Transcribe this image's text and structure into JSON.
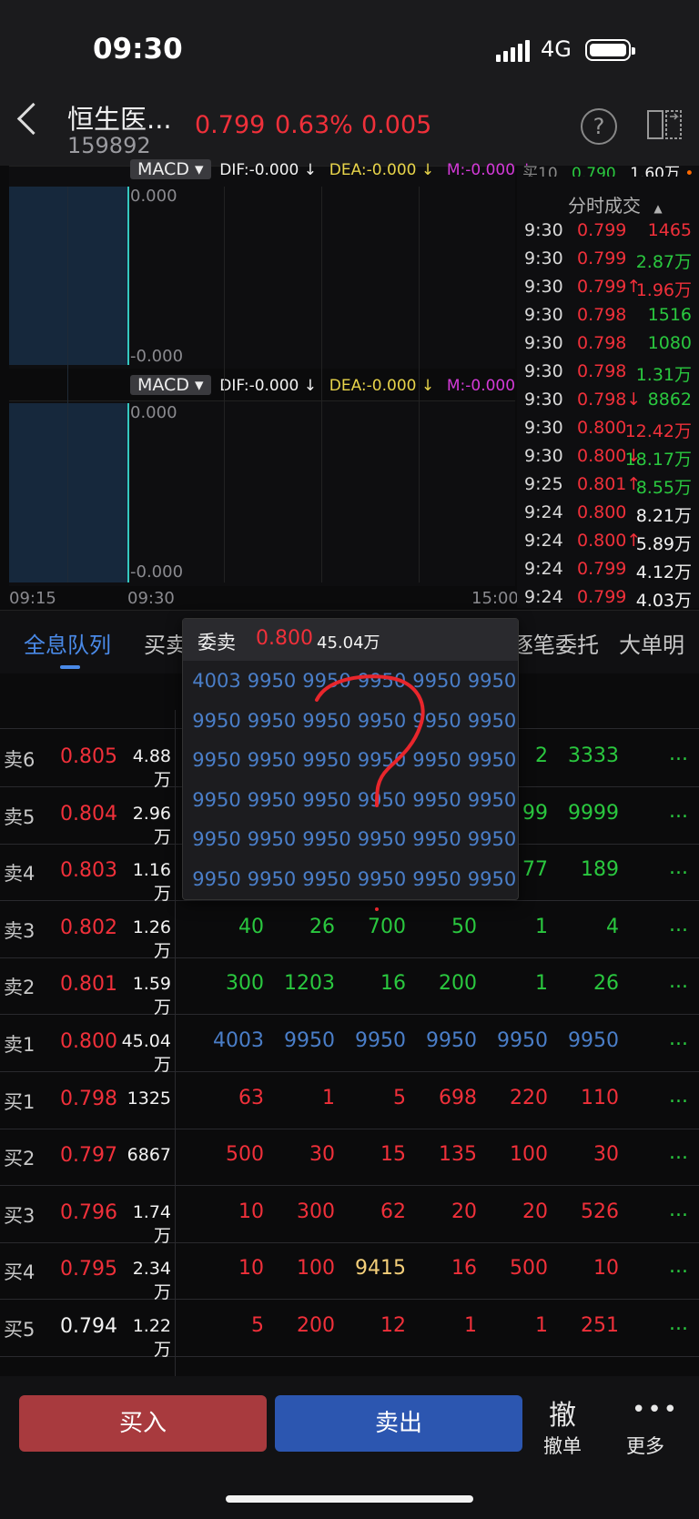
{
  "status_bar": {
    "time": "09:30",
    "network": "4G"
  },
  "header": {
    "name": "恒生医...",
    "code": "159892",
    "price": "0.799",
    "pct": "0.63%",
    "change": "0.005"
  },
  "indicators": [
    {
      "button": "MACD",
      "dif": "DIF:-0.000 ↓",
      "dea": "DEA:-0.000 ↓",
      "m": "M:-0.000 ↓",
      "top": "0.000",
      "bottom": "-0.000"
    },
    {
      "button": "MACD",
      "dif": "DIF:-0.000 ↓",
      "dea": "DEA:-0.000 ↓",
      "m": "M:-0.000 ↓",
      "top": "0.000",
      "bottom": "-0.000"
    }
  ],
  "time_axis": {
    "start": "09:15",
    "mid": "09:30",
    "end": "15:00"
  },
  "ticks": {
    "partial_top": {
      "label": "买10",
      "price": "0.790",
      "vol": "1.60万"
    },
    "header": "分时成交",
    "rows": [
      {
        "t": "9:30",
        "p": "0.799",
        "v": "1465",
        "pc": "red",
        "vc": "red"
      },
      {
        "t": "9:30",
        "p": "0.799",
        "v": "2.87万",
        "pc": "red",
        "vc": "green"
      },
      {
        "t": "9:30",
        "p": "0.799↑",
        "v": "1.96万",
        "pc": "red",
        "vc": "red"
      },
      {
        "t": "9:30",
        "p": "0.798",
        "v": "1516",
        "pc": "red",
        "vc": "green"
      },
      {
        "t": "9:30",
        "p": "0.798",
        "v": "1080",
        "pc": "red",
        "vc": "green"
      },
      {
        "t": "9:30",
        "p": "0.798",
        "v": "1.31万",
        "pc": "red",
        "vc": "green"
      },
      {
        "t": "9:30",
        "p": "0.798↓",
        "v": "8862",
        "pc": "red",
        "vc": "green"
      },
      {
        "t": "9:30",
        "p": "0.800",
        "v": "12.42万",
        "pc": "red",
        "vc": "red"
      },
      {
        "t": "9:30",
        "p": "0.800↓",
        "v": "18.17万",
        "pc": "red",
        "vc": "green"
      },
      {
        "t": "9:25",
        "p": "0.801↑",
        "v": "8.55万",
        "pc": "red",
        "vc": "green"
      },
      {
        "t": "9:24",
        "p": "0.800",
        "v": "8.21万",
        "pc": "red",
        "vc": "white"
      },
      {
        "t": "9:24",
        "p": "0.800↑",
        "v": "5.89万",
        "pc": "red",
        "vc": "white"
      },
      {
        "t": "9:24",
        "p": "0.799",
        "v": "4.12万",
        "pc": "red",
        "vc": "white"
      },
      {
        "t": "9:24",
        "p": "0.799",
        "v": "4.03万",
        "pc": "red",
        "vc": "white"
      }
    ]
  },
  "tabs": [
    "全息队列",
    "买卖",
    "逐笔委托",
    "大单明"
  ],
  "orderbook": [
    {
      "label": "卖6",
      "price": "0.805",
      "pc": "red",
      "vol": "4.88万",
      "cells": [
        "",
        "",
        "",
        "",
        "2",
        "3333"
      ],
      "cc": "green"
    },
    {
      "label": "卖5",
      "price": "0.804",
      "pc": "red",
      "vol": "2.96万",
      "cells": [
        "",
        "",
        "",
        "",
        "99",
        "9999"
      ],
      "cc": "green"
    },
    {
      "label": "卖4",
      "price": "0.803",
      "pc": "red",
      "vol": "1.16万",
      "cells": [
        "",
        "",
        "",
        "",
        "77",
        "189"
      ],
      "cc": "green"
    },
    {
      "label": "卖3",
      "price": "0.802",
      "pc": "red",
      "vol": "1.26万",
      "cells": [
        "40",
        "26",
        "700",
        "50",
        "1",
        "4"
      ],
      "cc": "green"
    },
    {
      "label": "卖2",
      "price": "0.801",
      "pc": "red",
      "vol": "1.59万",
      "cells": [
        "300",
        "1203",
        "16",
        "200",
        "1",
        "26"
      ],
      "cc": "green"
    },
    {
      "label": "卖1",
      "price": "0.800",
      "pc": "red",
      "vol": "45.04万",
      "cells": [
        "4003",
        "9950",
        "9950",
        "9950",
        "9950",
        "9950"
      ],
      "cc": "blue"
    },
    {
      "label": "买1",
      "price": "0.798",
      "pc": "red",
      "vol": "1325",
      "cells": [
        "63",
        "1",
        "5",
        "698",
        "220",
        "110"
      ],
      "cc": "red"
    },
    {
      "label": "买2",
      "price": "0.797",
      "pc": "red",
      "vol": "6867",
      "cells": [
        "500",
        "30",
        "15",
        "135",
        "100",
        "30"
      ],
      "cc": "red"
    },
    {
      "label": "买3",
      "price": "0.796",
      "pc": "red",
      "vol": "1.74万",
      "cells": [
        "10",
        "300",
        "62",
        "20",
        "20",
        "526"
      ],
      "cc": "red"
    },
    {
      "label": "买4",
      "price": "0.795",
      "pc": "red",
      "vol": "2.34万",
      "cells": [
        "10",
        "100",
        "9415",
        "16",
        "500",
        "10"
      ],
      "cc": "red",
      "highlight": 2
    },
    {
      "label": "买5",
      "price": "0.794",
      "pc": "white",
      "vol": "1.22万",
      "cells": [
        "5",
        "200",
        "12",
        "1",
        "1",
        "251"
      ],
      "cc": "red"
    }
  ],
  "more_label": "...",
  "popup": {
    "title": "委卖",
    "price": "0.800",
    "vol": "45.04万",
    "grid": [
      [
        "4003",
        "9950",
        "9950",
        "9950",
        "9950",
        "9950"
      ],
      [
        "9950",
        "9950",
        "9950",
        "9950",
        "9950",
        "9950"
      ],
      [
        "9950",
        "9950",
        "9950",
        "9950",
        "9950",
        "9950"
      ],
      [
        "9950",
        "9950",
        "9950",
        "9950",
        "9950",
        "9950"
      ],
      [
        "9950",
        "9950",
        "9950",
        "9950",
        "9950",
        "9950"
      ],
      [
        "9950",
        "9950",
        "9950",
        "9950",
        "9950",
        "9950"
      ]
    ]
  },
  "bottom_bar": {
    "buy": "买入",
    "sell": "卖出",
    "cancel_icon": "撤",
    "cancel": "撤单",
    "more_icon": "•••",
    "more": "更多"
  },
  "colors": {
    "red": "#f0303a",
    "green": "#2ac83f",
    "blue": "#4a7ec8",
    "buy_button": "#a83a3e",
    "sell_button": "#2c56b0",
    "annotation": "#e8262c"
  }
}
